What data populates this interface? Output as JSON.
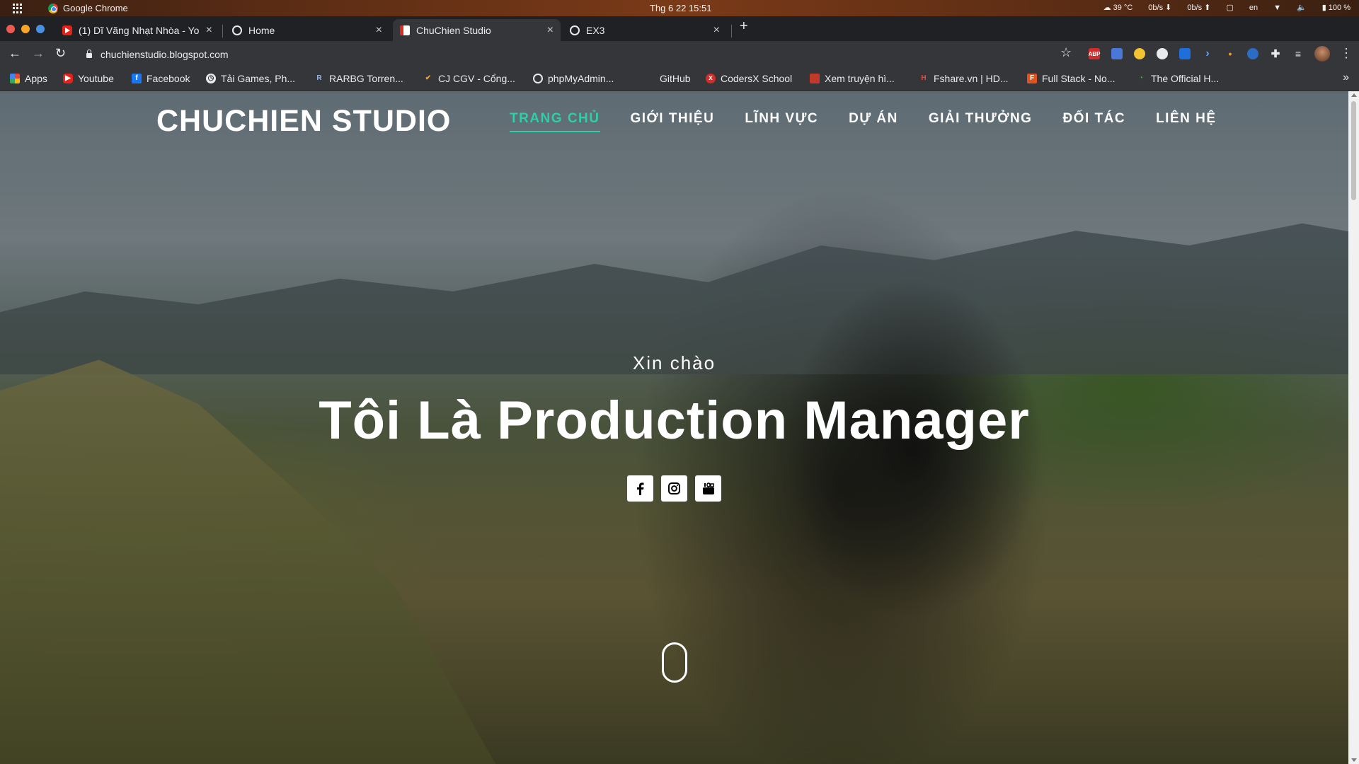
{
  "os": {
    "active_app": "Google Chrome",
    "clock": "Thg 6 22  15:51",
    "temperature": "39 °C",
    "net_down": "0b/s",
    "net_up": "0b/s",
    "lang": "en",
    "battery": "100 %"
  },
  "tabs": [
    {
      "title": "(1) Dĩ Vãng Nhạt Nhòa - Yo",
      "icon": "youtube-icon",
      "active": false
    },
    {
      "title": "Home",
      "icon": "globe-icon",
      "active": false
    },
    {
      "title": "ChuChien Studio",
      "icon": "blogger-icon",
      "active": true
    },
    {
      "title": "EX3",
      "icon": "globe-icon",
      "active": false
    }
  ],
  "toolbar": {
    "url": "chuchienstudio.blogspot.com",
    "adblock_label": "ABP"
  },
  "bookmarks": [
    {
      "label": "Apps",
      "icon": "apps-grid-icon"
    },
    {
      "label": "Youtube",
      "icon": "youtube-icon"
    },
    {
      "label": "Facebook",
      "icon": "facebook-icon"
    },
    {
      "label": "Tải Games, Ph...",
      "icon": "clock-icon"
    },
    {
      "label": "RARBG Torren...",
      "icon": "rarbg-icon"
    },
    {
      "label": "CJ CGV - Cổng...",
      "icon": "cgv-icon"
    },
    {
      "label": "phpMyAdmin...",
      "icon": "globe-icon"
    },
    {
      "label": "GitHub",
      "icon": "github-icon"
    },
    {
      "label": "CodersX School",
      "icon": "codersx-icon"
    },
    {
      "label": "Xem truyện hì...",
      "icon": "manga-icon"
    },
    {
      "label": "Fshare.vn | HD...",
      "icon": "fshare-icon"
    },
    {
      "label": "Full Stack - No...",
      "icon": "fullstack-icon"
    },
    {
      "label": "The Official H...",
      "icon": "official-icon"
    }
  ],
  "site": {
    "brand": "CHUCHIEN STUDIO",
    "menu": [
      "TRANG CHỦ",
      "GIỚI THIỆU",
      "LĨNH VỰC",
      "DỰ ÁN",
      "GIẢI THƯỞNG",
      "ĐỐI TÁC",
      "LIÊN HỆ"
    ],
    "active_menu": "TRANG CHỦ",
    "accent_color": "#2ecfa8",
    "hero_greeting": "Xin chào",
    "hero_title": "Tôi Là Production Manager",
    "socials": [
      "facebook-icon",
      "instagram-icon",
      "youtube-icon"
    ]
  }
}
